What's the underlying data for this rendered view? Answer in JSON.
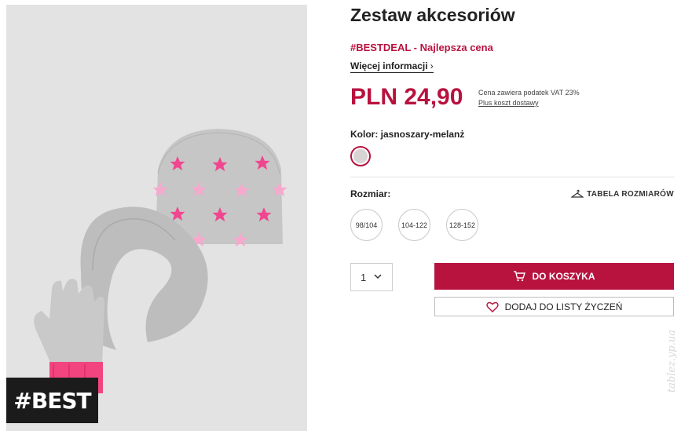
{
  "product": {
    "title": "Zestaw akcesoriów",
    "deal": "#BESTDEAL - Najlepsza cena",
    "more_info": "Więcej informacji",
    "price": "PLN 24,90",
    "tax_note": "Cena zawiera podatek VAT 23%",
    "shipping_link": "Plus koszt dostawy",
    "badge": "#BEST",
    "watermark": "tablez.yp.ua"
  },
  "color": {
    "label": "Kolor: jasnoszary-melanż",
    "swatch_color": "#d9d4d4"
  },
  "size": {
    "label": "Rozmiar:",
    "table_link": "TABELA ROZMIARÓW",
    "options": [
      "98/104",
      "104-122",
      "128-152"
    ]
  },
  "purchase": {
    "quantity": "1",
    "add_to_cart": "DO KOSZYKA",
    "add_to_wishlist": "DODAJ DO LISTY ŻYCZEŃ"
  },
  "colors": {
    "accent": "#b8123f",
    "image_bg": "#e3e3e3",
    "star_pink": "#f0468f",
    "star_light": "#f7a8cd",
    "knit_grey": "#c4c4c4",
    "cuff_pink": "#f2457f"
  },
  "icons": {
    "chevron": "chevron-right-icon",
    "hanger": "hanger-icon",
    "cart": "cart-icon",
    "heart": "heart-icon",
    "dropdown": "chevron-down-icon"
  }
}
